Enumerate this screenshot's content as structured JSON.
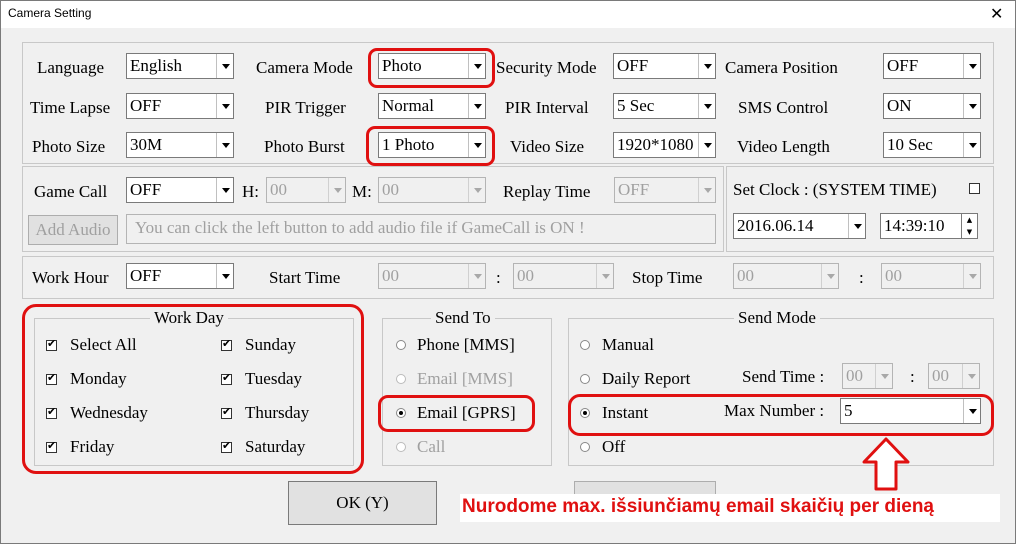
{
  "window": {
    "title": "Camera Setting",
    "close_glyph": "✕"
  },
  "row1": {
    "language_label": "Language",
    "language_value": "English",
    "camera_mode_label": "Camera Mode",
    "camera_mode_value": "Photo",
    "security_mode_label": "Security Mode",
    "security_mode_value": "OFF",
    "camera_position_label": "Camera Position",
    "camera_position_value": "OFF"
  },
  "row2": {
    "time_lapse_label": "Time Lapse",
    "time_lapse_value": "OFF",
    "pir_trigger_label": "PIR Trigger",
    "pir_trigger_value": "Normal",
    "pir_interval_label": "PIR Interval",
    "pir_interval_value": "5  Sec",
    "sms_control_label": "SMS Control",
    "sms_control_value": "ON"
  },
  "row3": {
    "photo_size_label": "Photo Size",
    "photo_size_value": "30M",
    "photo_burst_label": "Photo Burst",
    "photo_burst_value": "1 Photo",
    "video_size_label": "Video Size",
    "video_size_value": "1920*1080",
    "video_length_label": "Video Length",
    "video_length_value": "10  Sec"
  },
  "game_call": {
    "label": "Game Call",
    "value": "OFF",
    "h_label": "H:",
    "h_value": "00",
    "m_label": "M:",
    "m_value": "00",
    "replay_time_label": "Replay Time",
    "replay_time_value": "OFF",
    "add_audio_label": "Add Audio",
    "hint": "You can click the left button to add audio file if GameCall is ON !"
  },
  "clock": {
    "label": "Set Clock  : (SYSTEM TIME)",
    "date": "2016.06.14",
    "time": "14:39:10"
  },
  "work_hour": {
    "label": "Work Hour",
    "value": "OFF",
    "start_time_label": "Start Time",
    "start_hour": "00",
    "start_min": "00",
    "stop_time_label": "Stop Time",
    "stop_hour": "00",
    "stop_min": "00",
    "colon": ":"
  },
  "work_day": {
    "title": "Work Day",
    "select_all": "Select All",
    "monday": "Monday",
    "wednesday": "Wednesday",
    "friday": "Friday",
    "sunday": "Sunday",
    "tuesday": "Tuesday",
    "thursday": "Thursday",
    "saturday": "Saturday"
  },
  "send_to": {
    "title": "Send To",
    "phone_mms": "Phone [MMS]",
    "email_mms": "Email [MMS]",
    "email_gprs": "Email [GPRS]",
    "call": "Call"
  },
  "send_mode": {
    "title": "Send Mode",
    "manual": "Manual",
    "daily_report": "Daily Report",
    "send_time_label": "Send Time :",
    "send_hour": "00",
    "send_min": "00",
    "colon": ":",
    "instant": "Instant",
    "max_number_label": "Max Number :",
    "max_number_value": "5",
    "off": "Off"
  },
  "buttons": {
    "ok": "OK (Y)"
  },
  "annotation": {
    "text": "Nurodome max. išsiunčiamų  email skaičių per dieną",
    "color": "#e01010"
  },
  "colors": {
    "highlight": "#e01010",
    "background": "#f0f0f0"
  }
}
